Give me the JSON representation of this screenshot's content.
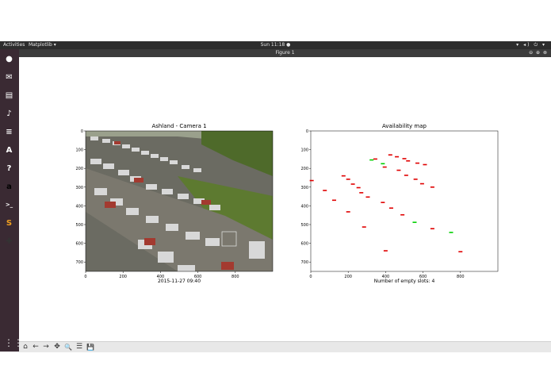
{
  "topbar": {
    "activities": "Activities",
    "app_menu": "Matplotlib ▾",
    "clock": "Sun 11:18 ●",
    "tray": "▾ ◂) ⏻ ▾"
  },
  "window": {
    "title": "Figure 1",
    "buttons": "⊖ ⊕ ⊗"
  },
  "dock": {
    "items": [
      {
        "name": "firefox",
        "glyph": "●",
        "color": "#e66000"
      },
      {
        "name": "thunderbird",
        "glyph": "✉",
        "color": "#3a6fb0"
      },
      {
        "name": "files",
        "glyph": "▤",
        "color": "#8a6d4a"
      },
      {
        "name": "rhythmbox",
        "glyph": "♪",
        "color": "#e8c040"
      },
      {
        "name": "writer",
        "glyph": "≡",
        "color": "#2a70c0"
      },
      {
        "name": "software",
        "glyph": "A",
        "color": "#e95420"
      },
      {
        "name": "help",
        "glyph": "?",
        "color": "#3b7cc4"
      },
      {
        "name": "amazon",
        "glyph": "a",
        "color": "#f2f2f2"
      },
      {
        "name": "terminal",
        "glyph": ">_",
        "color": "#2b2b2b"
      },
      {
        "name": "sublime",
        "glyph": "S",
        "color": "#4a4a4a"
      },
      {
        "name": "python",
        "glyph": "✚",
        "color": "#e0e0e0"
      }
    ],
    "apps_grid": "⋮⋮⋮"
  },
  "figure": {
    "left": {
      "title": "Ashland - Camera 1",
      "xticks": [
        "0",
        "200",
        "400",
        "600",
        "800"
      ],
      "yticks": [
        "0",
        "100",
        "200",
        "300",
        "400",
        "500",
        "600",
        "700"
      ],
      "xlabel": "2015-11-27 09:40"
    },
    "right": {
      "title": "Availability map",
      "xticks": [
        "0",
        "200",
        "400",
        "600",
        "800"
      ],
      "yticks": [
        "0",
        "100",
        "200",
        "300",
        "400",
        "500",
        "600",
        "700"
      ],
      "xlabel": "Number of empty slots: 4"
    }
  },
  "chart_data": {
    "type": "scatter",
    "title": "Availability map",
    "xlabel": "Number of empty slots: 4",
    "xlim": [
      0,
      1000
    ],
    "ylim": [
      750,
      0
    ],
    "series": [
      {
        "color": "#e00000",
        "points": [
          [
            5,
            265
          ],
          [
            75,
            318
          ],
          [
            125,
            370
          ],
          [
            175,
            240
          ],
          [
            200,
            258
          ],
          [
            225,
            284
          ],
          [
            255,
            303
          ],
          [
            270,
            330
          ],
          [
            305,
            353
          ],
          [
            345,
            150
          ],
          [
            385,
            382
          ],
          [
            395,
            193
          ],
          [
            425,
            128
          ],
          [
            430,
            412
          ],
          [
            460,
            138
          ],
          [
            470,
            210
          ],
          [
            490,
            448
          ],
          [
            500,
            148
          ],
          [
            510,
            237
          ],
          [
            520,
            160
          ],
          [
            560,
            258
          ],
          [
            570,
            172
          ],
          [
            595,
            282
          ],
          [
            610,
            180
          ],
          [
            650,
            300
          ],
          [
            650,
            522
          ],
          [
            200,
            432
          ],
          [
            285,
            513
          ],
          [
            400,
            640
          ],
          [
            800,
            645
          ]
        ]
      },
      {
        "color": "#00d000",
        "points": [
          [
            325,
            155
          ],
          [
            385,
            175
          ],
          [
            555,
            488
          ],
          [
            750,
            542
          ]
        ]
      }
    ]
  },
  "toolbar": {
    "home": "⌂",
    "back": "←",
    "forward": "→",
    "pan": "✥",
    "zoom": "🔍",
    "configure": "☰",
    "save": "💾"
  }
}
